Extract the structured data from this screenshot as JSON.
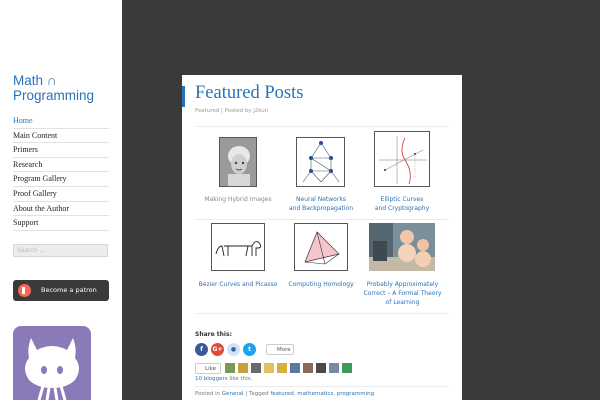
{
  "site": {
    "title": "Math ∩ Programming"
  },
  "nav": {
    "items": [
      {
        "label": "Home"
      },
      {
        "label": "Main Content"
      },
      {
        "label": "Primers"
      },
      {
        "label": "Research"
      },
      {
        "label": "Program Gallery"
      },
      {
        "label": "Proof Gallery"
      },
      {
        "label": "About the Author"
      },
      {
        "label": "Support"
      }
    ]
  },
  "search": {
    "placeholder": "Search ..."
  },
  "patreon": {
    "label": "Become a patron"
  },
  "post": {
    "title": "Featured Posts",
    "meta_prefix": "Featured | Posted by",
    "meta_author": "j2kun"
  },
  "featured": [
    {
      "caption": "Making Hybrid Images",
      "thumb": "hybrid-portrait"
    },
    {
      "caption_line1": "Neural Networks",
      "caption_line2": "and Backpropagation",
      "thumb": "neural-network-graph"
    },
    {
      "caption_line1": "Elliptic Curves",
      "caption_line2": "and Cryptography",
      "thumb": "elliptic-curve-plot"
    },
    {
      "caption": "Bezier Curves and Picasso",
      "thumb": "picasso-dog-line"
    },
    {
      "caption": "Computing Homology",
      "thumb": "simplicial-complex"
    },
    {
      "caption_line1": "Probably Approximately",
      "caption_line2": "Correct – A Formal Theory",
      "caption_line3": "of Learning",
      "thumb": "baby-with-robot-photo"
    }
  ],
  "share": {
    "heading": "Share this:",
    "buttons": [
      {
        "name": "facebook",
        "glyph": "f",
        "color": "#3b5998"
      },
      {
        "name": "google-plus",
        "glyph": "G+",
        "color": "#dd4b39"
      },
      {
        "name": "reddit",
        "glyph": "●",
        "color": "#cee3f8"
      },
      {
        "name": "twitter",
        "glyph": "t",
        "color": "#1da1f2"
      }
    ],
    "more_label": "More"
  },
  "likes": {
    "button_label": "Like",
    "count_label": "10 bloggers",
    "suffix": "like this."
  },
  "footer": {
    "posted_in": "Posted in",
    "category": "General",
    "tagged": "| Tagged",
    "tags": [
      "featured",
      "mathematics",
      "programming"
    ]
  }
}
